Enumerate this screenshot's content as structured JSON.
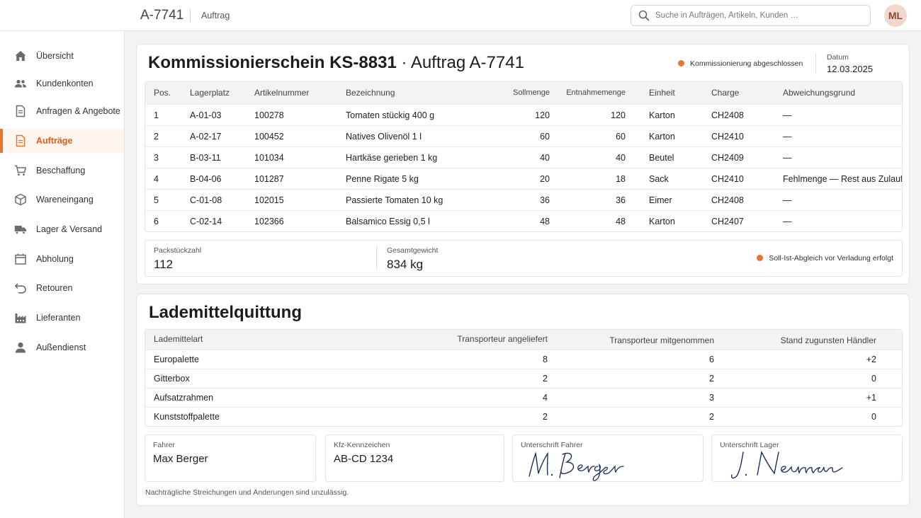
{
  "header": {
    "order_id": "A-7741",
    "breadcrumb": "Auftrag",
    "search_placeholder": "Suche in Aufträgen, Artikeln, Kunden …",
    "avatar_initials": "ML"
  },
  "sidebar": {
    "items": [
      {
        "label": "Übersicht",
        "icon": "home-icon"
      },
      {
        "label": "Kundenkonten",
        "icon": "users-icon"
      },
      {
        "label": "Anfragen & Angebote",
        "icon": "document-icon"
      },
      {
        "label": "Aufträge",
        "icon": "document-icon",
        "active": true
      },
      {
        "label": "Beschaffung",
        "icon": "cart-icon"
      },
      {
        "label": "Wareneingang",
        "icon": "box-icon"
      },
      {
        "label": "Lager & Versand",
        "icon": "truck-icon"
      },
      {
        "label": "Abholung",
        "icon": "calendar-icon"
      },
      {
        "label": "Retouren",
        "icon": "return-icon"
      },
      {
        "label": "Lieferanten",
        "icon": "factory-icon"
      },
      {
        "label": "Außendienst",
        "icon": "person-icon"
      }
    ]
  },
  "picklist": {
    "title": "Kommissionierschein KS-8831",
    "title_suffix": "· Auftrag A-7741",
    "status": "Kommissionierung abgeschlossen",
    "date_label": "Datum",
    "date_value": "12.03.2025",
    "columns": [
      "Pos.",
      "Lagerplatz",
      "Artikelnummer",
      "Bezeichnung",
      "Sollmenge",
      "Entnahmemenge",
      "Einheit",
      "Charge",
      "Abweichungsgrund"
    ],
    "rows": [
      [
        "1",
        "A-01-03",
        "100278",
        "Tomaten stückig 400 g",
        "120",
        "120",
        "Karton",
        "CH2408",
        "—"
      ],
      [
        "2",
        "A-02-17",
        "100452",
        "Natives Olivenöl 1 l",
        "60",
        "60",
        "Karton",
        "CH2410",
        "—"
      ],
      [
        "3",
        "B-03-11",
        "101034",
        "Hartkäse gerieben 1 kg",
        "40",
        "40",
        "Beutel",
        "CH2409",
        "—"
      ],
      [
        "4",
        "B-04-06",
        "101287",
        "Penne Rigate 5 kg",
        "20",
        "18",
        "Sack",
        "CH2410",
        "Fehlmenge — Rest aus Zulauf"
      ],
      [
        "5",
        "C-01-08",
        "102015",
        "Passierte Tomaten 10 kg",
        "36",
        "36",
        "Eimer",
        "CH2408",
        "—"
      ],
      [
        "6",
        "C-02-14",
        "102366",
        "Balsamico Essig 0,5 l",
        "48",
        "48",
        "Karton",
        "CH2407",
        "—"
      ]
    ],
    "totals": {
      "packages_label": "Packstückzahl",
      "packages_value": "112",
      "weight_label": "Gesamtgewicht",
      "weight_value": "834 kg",
      "note": "Soll-Ist-Abgleich vor Verladung erfolgt"
    }
  },
  "receipt": {
    "title": "Lademittelquittung",
    "columns": [
      "Lademittelart",
      "Transporteur angeliefert",
      "Transporteur mitgenommen",
      "Stand zugunsten Händler"
    ],
    "rows": [
      [
        "Europalette",
        "8",
        "6",
        "+2"
      ],
      [
        "Gitterbox",
        "2",
        "2",
        "0"
      ],
      [
        "Aufsatzrahmen",
        "4",
        "3",
        "+1"
      ],
      [
        "Kunststoffpalette",
        "2",
        "2",
        "0"
      ]
    ],
    "driver_label": "Fahrer",
    "driver_value": "Max Berger",
    "plate_label": "Kfz-Kennzeichen",
    "plate_value": "AB-CD 1234",
    "sig_driver_label": "Unterschrift Fahrer",
    "sig_driver_text": "M. Berger",
    "sig_storage_label": "Unterschrift Lager",
    "sig_storage_text": "J. Neumann",
    "footnote": "Nachträgliche Streichungen und Änderungen sind unzulässig."
  },
  "colors": {
    "accent": "#e8742f",
    "active_bg": "#fff5ef",
    "signature_ink": "#1f2d5c"
  }
}
